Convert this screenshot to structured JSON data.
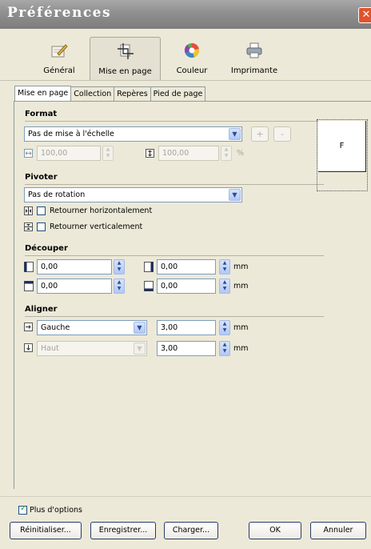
{
  "window": {
    "title": "Préférences",
    "close_glyph": "✕"
  },
  "toolbar": {
    "items": [
      {
        "label": "Général",
        "icon": "pencil-notepad-icon"
      },
      {
        "label": "Mise en page",
        "icon": "crop-icon",
        "active": true
      },
      {
        "label": "Couleur",
        "icon": "color-wheel-icon"
      },
      {
        "label": "Imprimante",
        "icon": "printer-icon"
      }
    ]
  },
  "tabs": [
    "Mise en page",
    "Collection",
    "Repères",
    "Pied de page"
  ],
  "format": {
    "title": "Format",
    "scale_value": "Pas de mise à l'échelle",
    "plus": "+",
    "minus": "-",
    "width_value": "100,00",
    "height_value": "100,00",
    "unit": "%"
  },
  "pivoter": {
    "title": "Pivoter",
    "rotation_value": "Pas de rotation",
    "flip_h_label": "Retourner horizontalement",
    "flip_v_label": "Retourner verticalement"
  },
  "decouper": {
    "title": "Découper",
    "left_value": "0,00",
    "right_value": "0,00",
    "top_value": "0,00",
    "bottom_value": "0,00",
    "unit": "mm"
  },
  "aligner": {
    "title": "Aligner",
    "horizontal_value": "Gauche",
    "horizontal_offset": "3,00",
    "vertical_value": "Haut",
    "vertical_offset": "3,00",
    "unit": "mm"
  },
  "preview": {
    "letter": "F"
  },
  "footer": {
    "more_options": "Plus d'options",
    "more_options_checked": true,
    "buttons": {
      "reset": "Réinitialiser...",
      "save": "Enregistrer...",
      "load": "Charger...",
      "ok": "OK",
      "cancel": "Annuler"
    }
  },
  "colors": {
    "close": "#e0532d",
    "title_bar": "#8f8f8f",
    "background": "#ECE9D8",
    "field_border": "#7f9db9"
  }
}
